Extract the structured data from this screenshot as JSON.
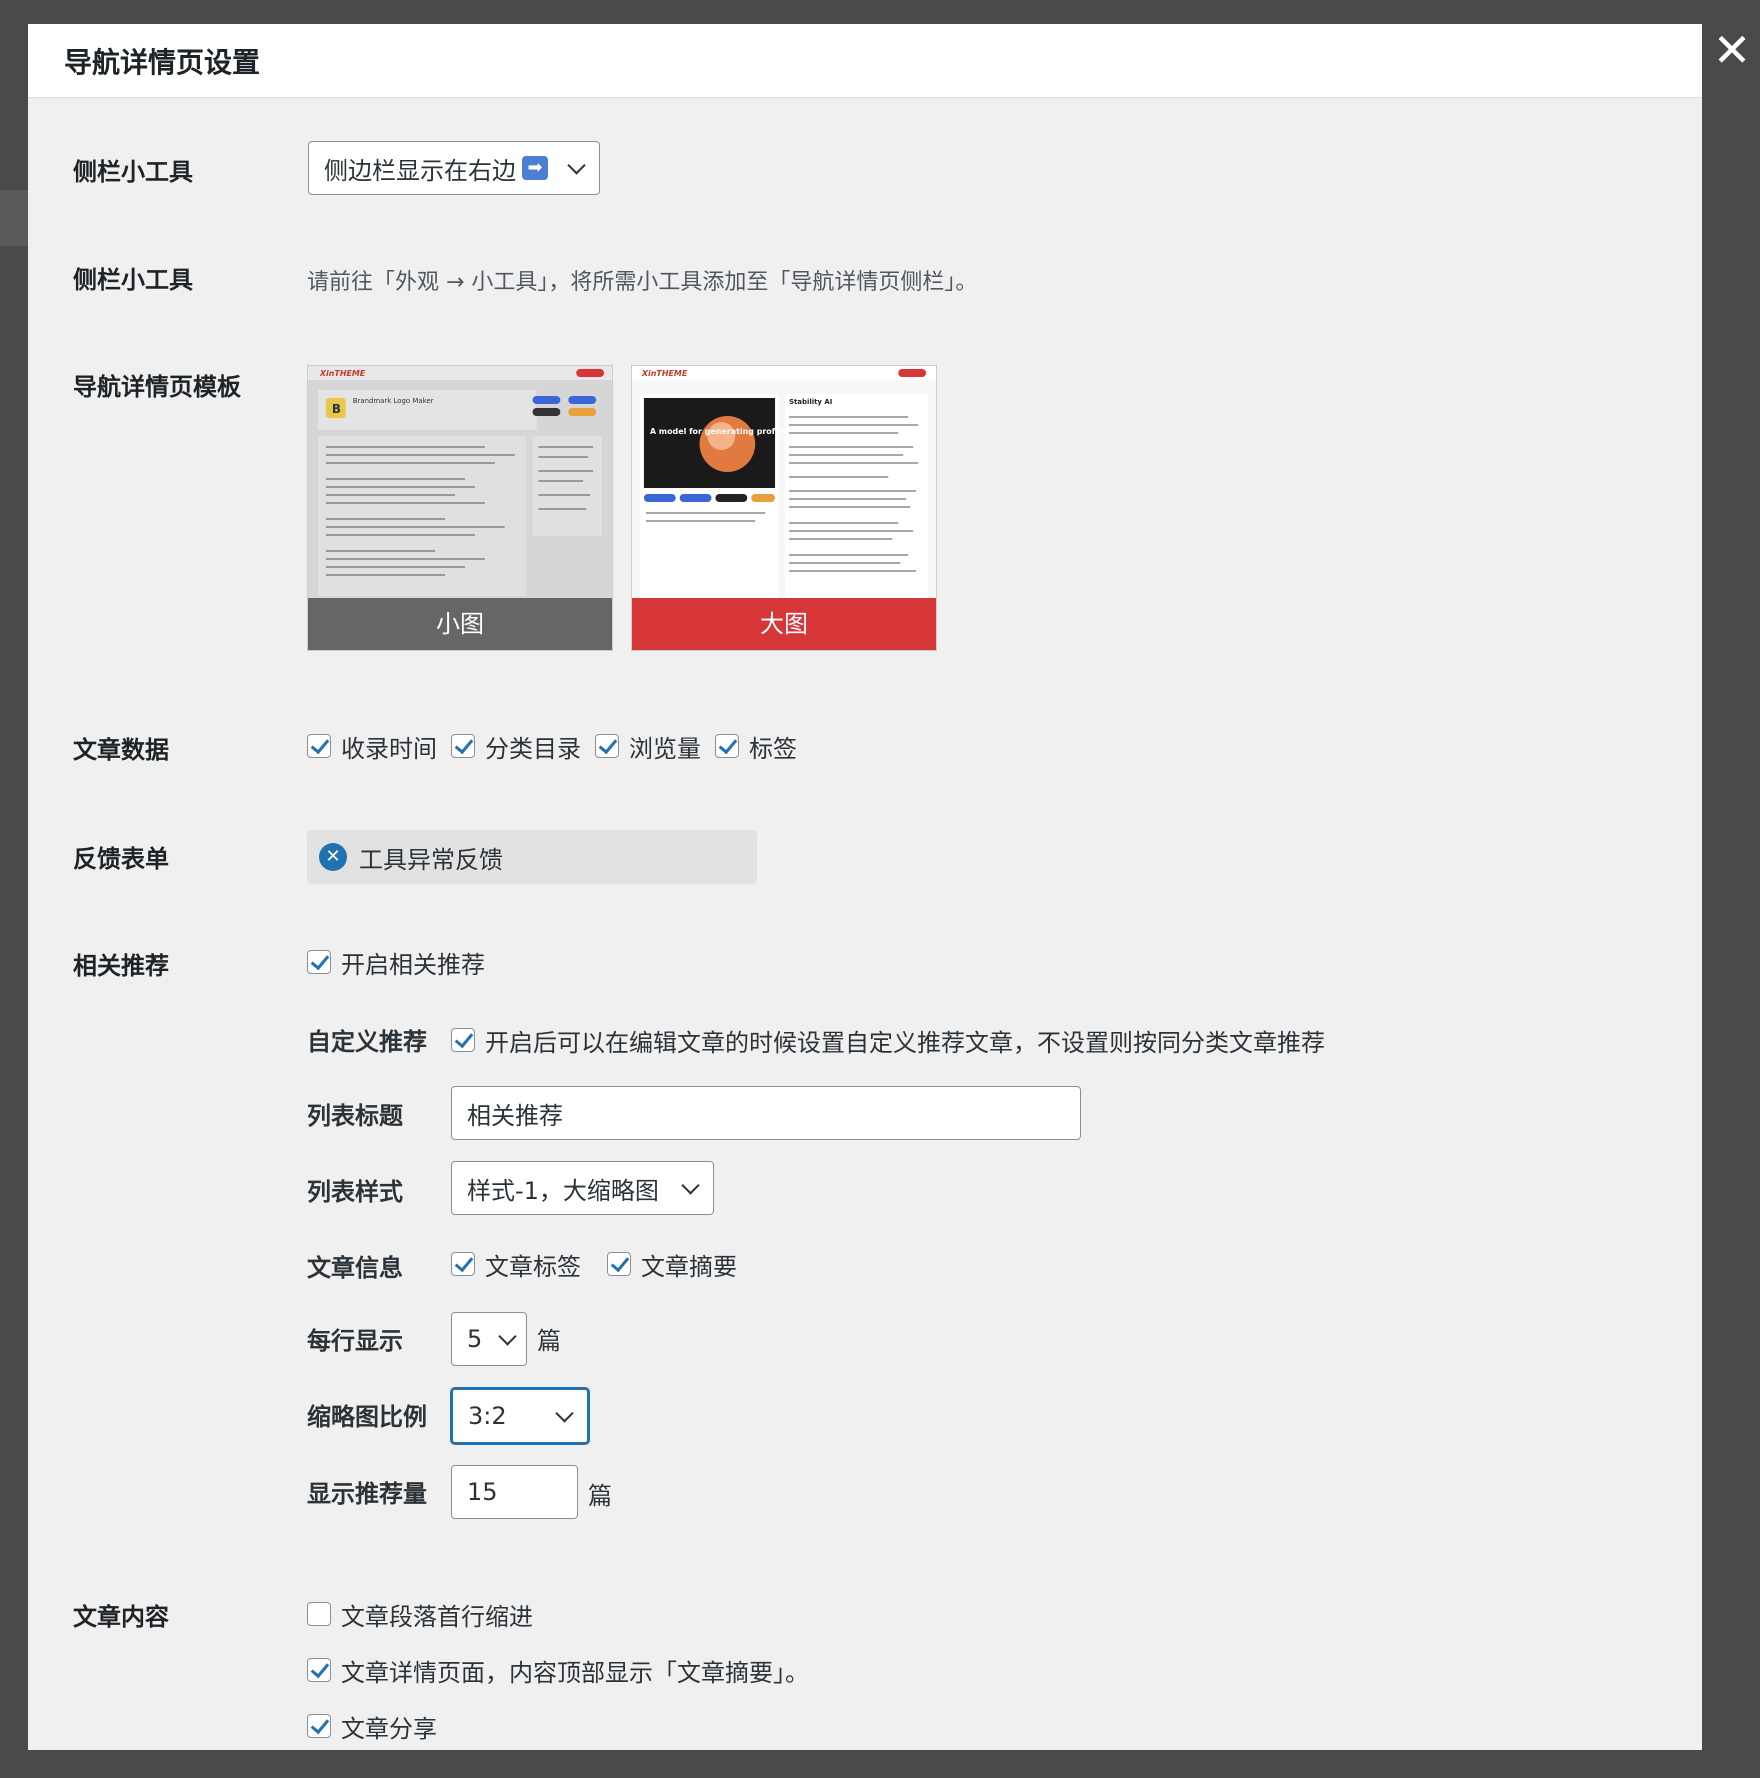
{
  "modal": {
    "title": "导航详情页设置",
    "close": "✕"
  },
  "sidebar": {
    "label": "侧栏小工具",
    "select_value": "侧边栏显示在右边",
    "select_emoji": "➡",
    "info_label": "侧栏小工具",
    "info_text": "请前往「外观 → 小工具」，将所需小工具添加至「导航详情页侧栏」。"
  },
  "template": {
    "label": "导航详情页模板",
    "options": [
      {
        "label": "小图",
        "selected": false,
        "bar_color": "#666666"
      },
      {
        "label": "大图",
        "selected": true,
        "bar_color": "#d63638"
      }
    ],
    "thumb_small": {
      "logo": "XinTHEME",
      "title": "Brandmark Logo Maker",
      "badge": "B"
    },
    "thumb_large": {
      "logo": "XinTHEME",
      "title": "Stability AI",
      "hero_text": "A model for generating professional-grade images."
    }
  },
  "post_data": {
    "label": "文章数据",
    "items": [
      {
        "label": "收录时间",
        "checked": true
      },
      {
        "label": "分类目录",
        "checked": true
      },
      {
        "label": "浏览量",
        "checked": true
      },
      {
        "label": "标签",
        "checked": true
      }
    ]
  },
  "feedback": {
    "label": "反馈表单",
    "value": "工具异常反馈"
  },
  "related": {
    "label": "相关推荐",
    "enable_label": "开启相关推荐",
    "enable_checked": true,
    "custom_label": "自定义推荐",
    "custom_checked": true,
    "custom_text": "开启后可以在编辑文章的时候设置自定义推荐文章，不设置则按同分类文章推荐",
    "list_title_label": "列表标题",
    "list_title_value": "相关推荐",
    "list_style_label": "列表样式",
    "list_style_value": "样式-1，大缩略图",
    "post_info_label": "文章信息",
    "post_info_items": [
      {
        "label": "文章标签",
        "checked": true
      },
      {
        "label": "文章摘要",
        "checked": true
      }
    ],
    "per_row_label": "每行显示",
    "per_row_value": "5",
    "per_row_unit": "篇",
    "ratio_label": "缩略图比例",
    "ratio_value": "3:2",
    "count_label": "显示推荐量",
    "count_value": "15",
    "count_unit": "篇"
  },
  "content": {
    "label": "文章内容",
    "items": [
      {
        "label": "文章段落首行缩进",
        "checked": false
      },
      {
        "label": "文章详情页面，内容顶部显示「文章摘要」。",
        "checked": true
      },
      {
        "label": "文章分享",
        "checked": true
      }
    ]
  },
  "colors": {
    "accent": "#2271b1",
    "selected_template": "#d63638",
    "unselected_template": "#666666"
  }
}
